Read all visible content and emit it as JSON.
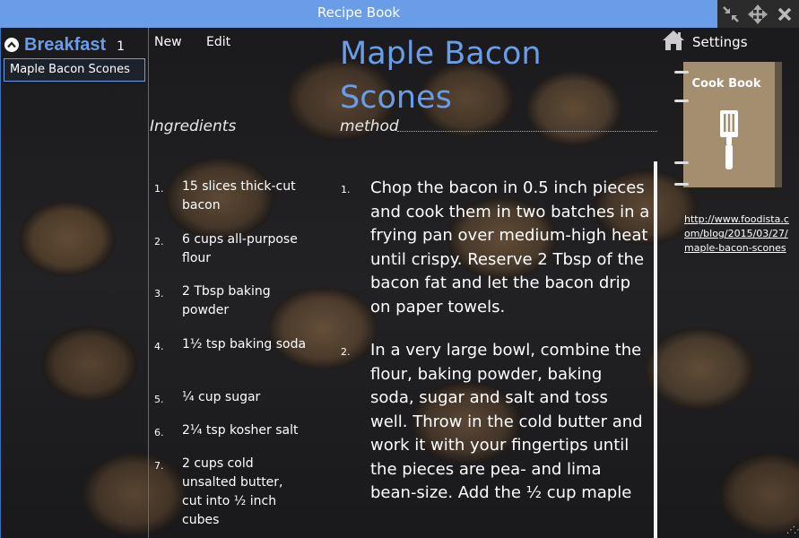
{
  "window": {
    "title": "Recipe Book"
  },
  "window_controls": {
    "restore_icon": "restore-arrows-icon",
    "move_icon": "move-arrows-icon",
    "close_icon": "close-icon"
  },
  "sidebar": {
    "category": {
      "name": "Breakfast",
      "count": "1",
      "icon": "chevron-up-circle-icon"
    },
    "recipes": [
      "Maple Bacon Scones"
    ],
    "selected_index": 0
  },
  "toolbar": {
    "new_label": "New",
    "edit_label": "Edit"
  },
  "recipe": {
    "title": "Maple Bacon Scones",
    "ingredients_heading": "Ingredients",
    "method_heading": "method",
    "ingredients": [
      {
        "num": "1.",
        "text": "15 slices thick-cut bacon"
      },
      {
        "num": "2.",
        "text": "6 cups all-purpose flour"
      },
      {
        "num": "3.",
        "text": "2 Tbsp baking powder"
      },
      {
        "num": "4.",
        "text": "1½ tsp baking soda"
      },
      {
        "num": "5.",
        "text": "¼ cup sugar"
      },
      {
        "num": "6.",
        "text": "2¼ tsp kosher salt"
      },
      {
        "num": "7.",
        "text": "2 cups cold unsalted butter, cut into ½ inch cubes"
      }
    ],
    "steps": [
      {
        "num": "1.",
        "text": "Chop the bacon in 0.5 inch pieces and cook them in two batches in a frying pan over medium-high heat until crispy. Reserve 2 Tbsp of the bacon fat and let the bacon drip on paper towels."
      },
      {
        "num": "2.",
        "text": "In a very large bowl, combine the flour, baking powder, baking soda, sugar and salt and toss well. Throw in the cold butter and work it with your fingertips until the pieces are pea- and lima bean-size. Add the ½ cup maple"
      }
    ]
  },
  "settings": {
    "label": "Settings",
    "icon": "home-icon"
  },
  "cookbook": {
    "title": "Cook Book",
    "icon": "spatula-icon"
  },
  "source": {
    "url": "http://www.foodista.com/blog/2015/03/27/maple-bacon-scones"
  }
}
